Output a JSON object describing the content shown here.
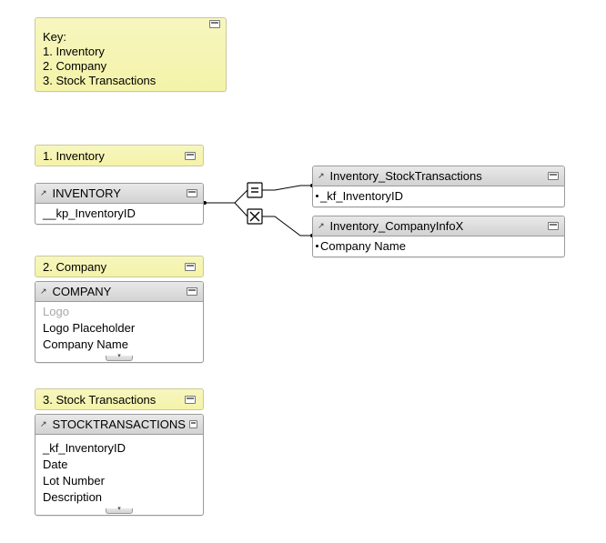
{
  "key": {
    "heading": "Key:",
    "items": [
      "1. Inventory",
      "2. Company",
      "3. Stock Transactions"
    ]
  },
  "sections": [
    {
      "label": "1. Inventory"
    },
    {
      "label": "2. Company"
    },
    {
      "label": "3. Stock Transactions"
    }
  ],
  "tables": {
    "inventory": {
      "title": "INVENTORY",
      "fields": [
        "__kp_InventoryID"
      ]
    },
    "inv_stocktrans": {
      "title": "Inventory_StockTransactions",
      "fields": [
        "_kf_InventoryID"
      ]
    },
    "inv_companyx": {
      "title": "Inventory_CompanyInfoX",
      "fields": [
        "Company Name"
      ]
    },
    "company": {
      "title": "COMPANY",
      "fields": [
        "Logo",
        "Logo Placeholder",
        "Company Name"
      ]
    },
    "stocktrans": {
      "title": "STOCKTRANSACTIONS",
      "fields": [
        "_kf_InventoryID",
        "Date",
        "Lot Number",
        "Description"
      ]
    }
  },
  "relations": [
    {
      "from": "inventory",
      "to": "inv_stocktrans",
      "op": "equal"
    },
    {
      "from": "inventory",
      "to": "inv_companyx",
      "op": "cross"
    }
  ]
}
